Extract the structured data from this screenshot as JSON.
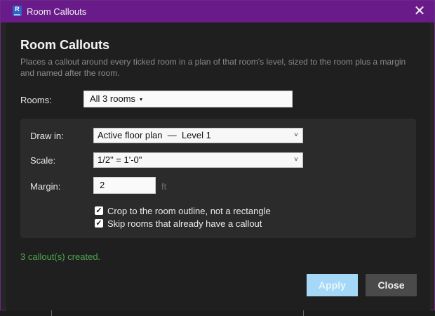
{
  "window": {
    "title": "Room Callouts",
    "app_icon_letter": "R",
    "close_icon": "close-icon"
  },
  "dialog": {
    "heading": "Room Callouts",
    "description": "Places a callout around every ticked room in a plan of that room's level, sized to the room plus a margin and named after the room."
  },
  "rooms": {
    "label": "Rooms:",
    "value": "All 3 rooms",
    "caret": "▾"
  },
  "panel": {
    "draw_in_label": "Draw in:",
    "draw_in_value": "Active floor plan  —  Level 1",
    "scale_label": "Scale:",
    "scale_value": "1/2\" = 1'-0\"",
    "margin_label": "Margin:",
    "margin_value": "2",
    "margin_unit": "ft",
    "checkboxes": [
      {
        "label": "Crop to the room outline, not a rectangle",
        "checked": true
      },
      {
        "label": "Skip rooms that already have a callout",
        "checked": true
      }
    ]
  },
  "status": {
    "text": "3 callout(s) created.",
    "color": "#4fa64f"
  },
  "buttons": {
    "apply": "Apply",
    "close": "Close"
  },
  "colors": {
    "titlebar": "#6a1b8a",
    "apply_disabled": "#a5d8f6"
  }
}
